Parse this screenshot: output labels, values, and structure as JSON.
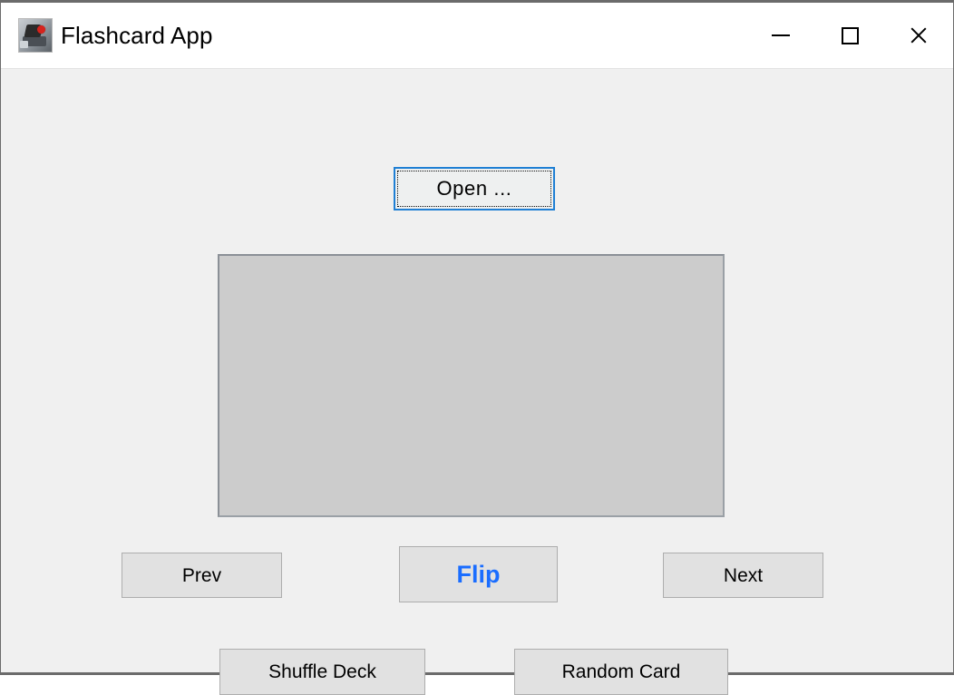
{
  "window": {
    "title": "Flashcard App",
    "icon": "app-icon",
    "controls": {
      "minimize": "minimize-icon",
      "maximize": "maximize-icon",
      "close": "close-icon"
    }
  },
  "colors": {
    "window_background": "#f0f0f0",
    "titlebar_background": "#ffffff",
    "button_face": "#e1e1e1",
    "button_border": "#adadad",
    "focus_border": "#1f7fd4",
    "card_face": "#cccccc",
    "card_border": "#8b9097",
    "flip_accent": "#1a6dff",
    "text": "#000000"
  },
  "toolbar": {
    "open_label": "Open ..."
  },
  "card": {
    "text": "",
    "placeholder": ""
  },
  "nav": {
    "prev_label": "Prev",
    "flip_label": "Flip",
    "next_label": "Next"
  },
  "deck": {
    "shuffle_label": "Shuffle Deck",
    "random_label": "Random Card"
  }
}
